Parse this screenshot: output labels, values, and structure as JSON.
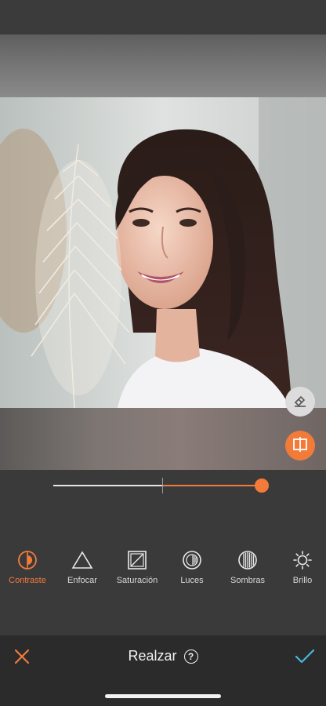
{
  "editor": {
    "title": "Realzar",
    "help_glyph": "?",
    "close_icon": "close-icon",
    "confirm_icon": "checkmark-icon",
    "help_icon": "help-circle-icon"
  },
  "canvas": {
    "photo_description_icon": "portrait-photo",
    "eraser_icon": "eraser-icon",
    "compare_icon": "split-compare-icon"
  },
  "slider": {
    "value_fraction": 0.96,
    "center_fraction": 0.52
  },
  "tools": [
    {
      "label": "Contraste",
      "icon": "contrast-icon",
      "active": true
    },
    {
      "label": "Enfocar",
      "icon": "triangle-sharpen-icon",
      "active": false
    },
    {
      "label": "Saturación",
      "icon": "saturation-square-icon",
      "active": false
    },
    {
      "label": "Luces",
      "icon": "highlights-icon",
      "active": false
    },
    {
      "label": "Sombras",
      "icon": "shadows-icon",
      "active": false
    },
    {
      "label": "Brillo",
      "icon": "brightness-sun-icon",
      "active": false
    }
  ],
  "colors": {
    "accent": "#f27b3a",
    "confirm": "#47b8e0",
    "background": "#3a3a3a",
    "bottom_bar": "#2b2b2b"
  }
}
